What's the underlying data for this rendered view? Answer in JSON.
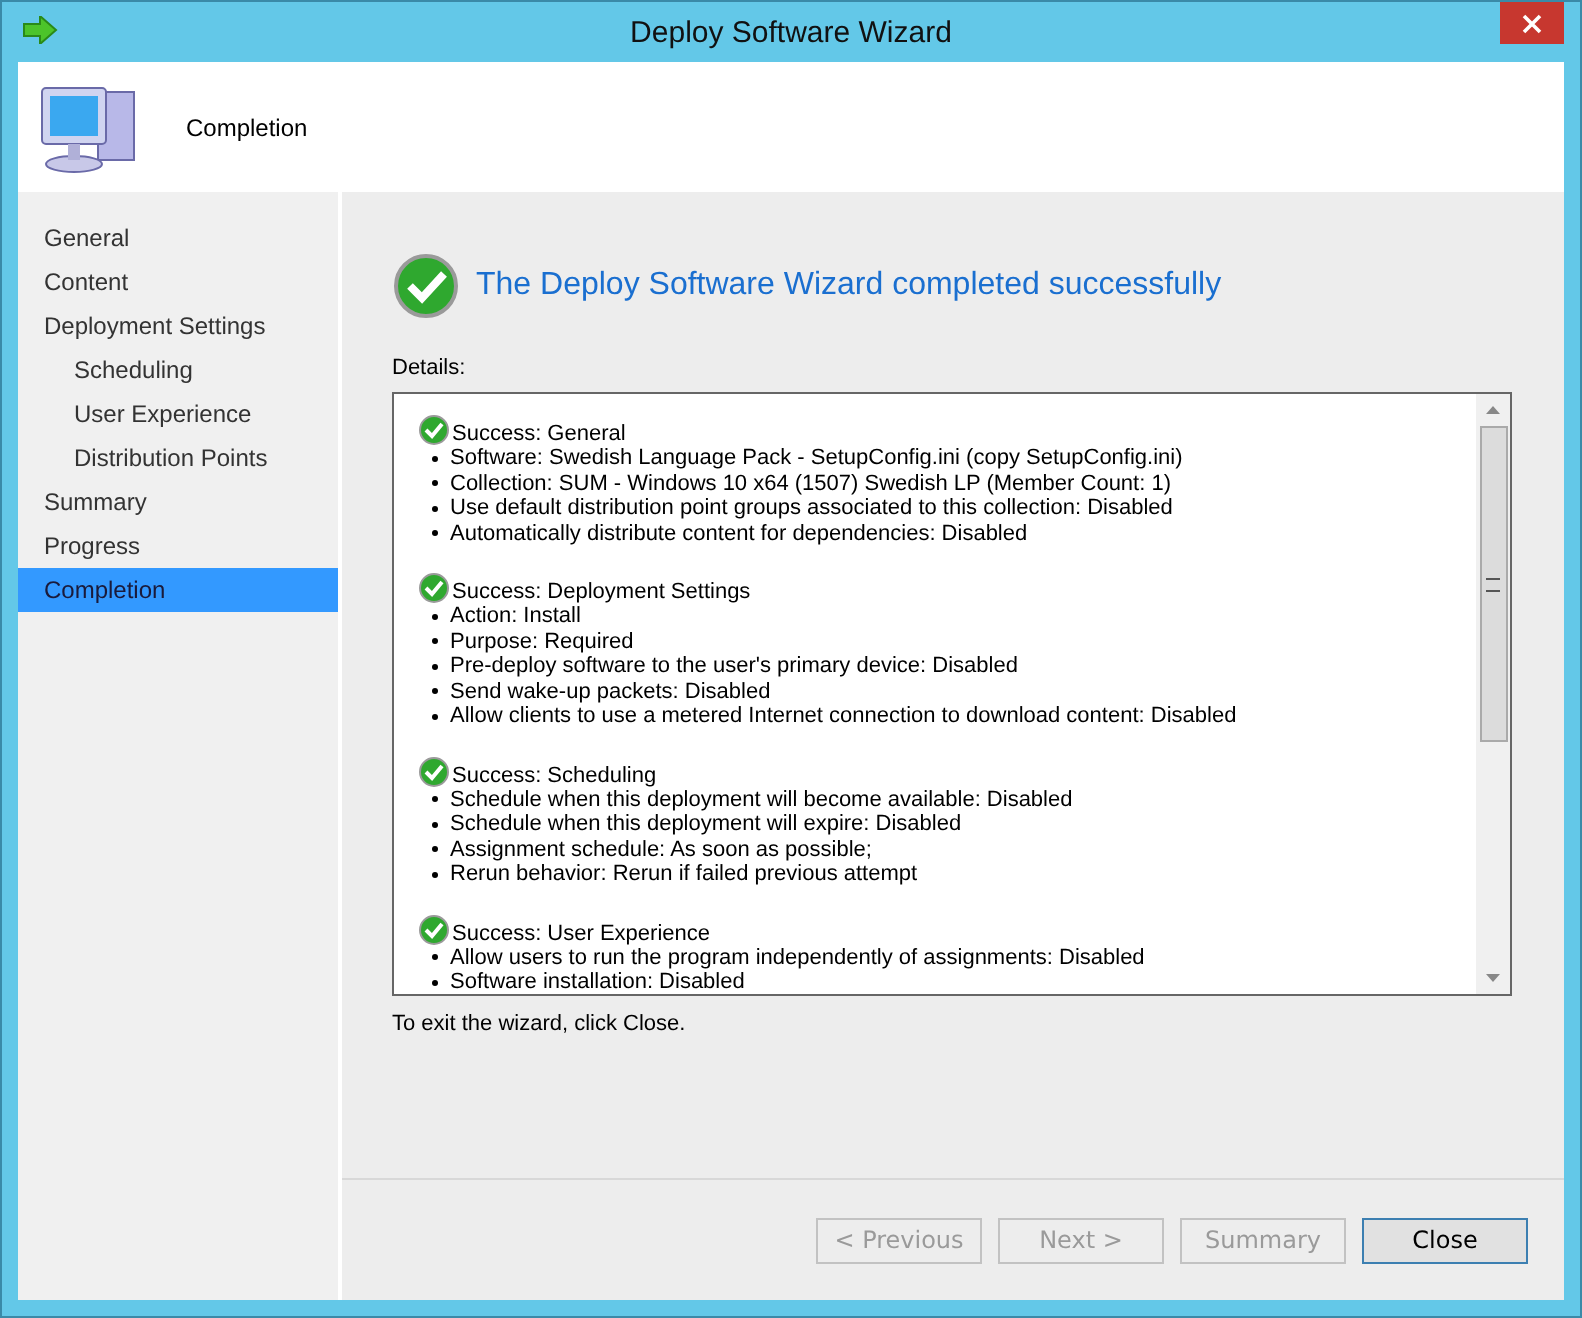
{
  "window": {
    "title": "Deploy Software Wizard"
  },
  "header": {
    "title": "Completion"
  },
  "sidebar": {
    "items": [
      {
        "label": "General",
        "selected": false
      },
      {
        "label": "Content",
        "selected": false
      },
      {
        "label": "Deployment Settings",
        "selected": false,
        "children": [
          {
            "label": "Scheduling",
            "selected": false
          },
          {
            "label": "User Experience",
            "selected": false
          },
          {
            "label": "Distribution Points",
            "selected": false
          }
        ]
      },
      {
        "label": "Summary",
        "selected": false
      },
      {
        "label": "Progress",
        "selected": false
      },
      {
        "label": "Completion",
        "selected": true
      }
    ]
  },
  "result": {
    "message": "The Deploy Software Wizard completed successfully"
  },
  "details": {
    "label": "Details:",
    "sections": [
      {
        "title": "Success: General",
        "items": [
          "Software: Swedish Language Pack - SetupConfig.ini (copy SetupConfig.ini)",
          "Collection: SUM - Windows 10 x64 (1507) Swedish LP (Member Count: 1)",
          "Use default distribution point groups associated to this collection: Disabled",
          "Automatically distribute content for dependencies: Disabled"
        ]
      },
      {
        "title": "Success: Deployment Settings",
        "items": [
          "Action: Install",
          "Purpose: Required",
          "Pre-deploy software to the user's primary device: Disabled",
          "Send wake-up packets: Disabled",
          "Allow clients to use a metered Internet connection to download content: Disabled"
        ]
      },
      {
        "title": "Success: Scheduling",
        "items": [
          "Schedule when this deployment will become available: Disabled",
          "Schedule when this deployment will expire: Disabled",
          "Assignment schedule: As soon as possible;",
          "Rerun behavior: Rerun if failed previous attempt"
        ]
      },
      {
        "title": "Success: User Experience",
        "items": [
          "Allow users to run the program independently of assignments: Disabled",
          "Software installation: Disabled"
        ]
      }
    ]
  },
  "hint": "To exit the wizard, click Close.",
  "buttons": [
    {
      "label": "< Previous",
      "disabled": true
    },
    {
      "label": "Next >",
      "disabled": true
    },
    {
      "label": "Summary",
      "disabled": true
    },
    {
      "label": "Close",
      "disabled": false
    }
  ]
}
